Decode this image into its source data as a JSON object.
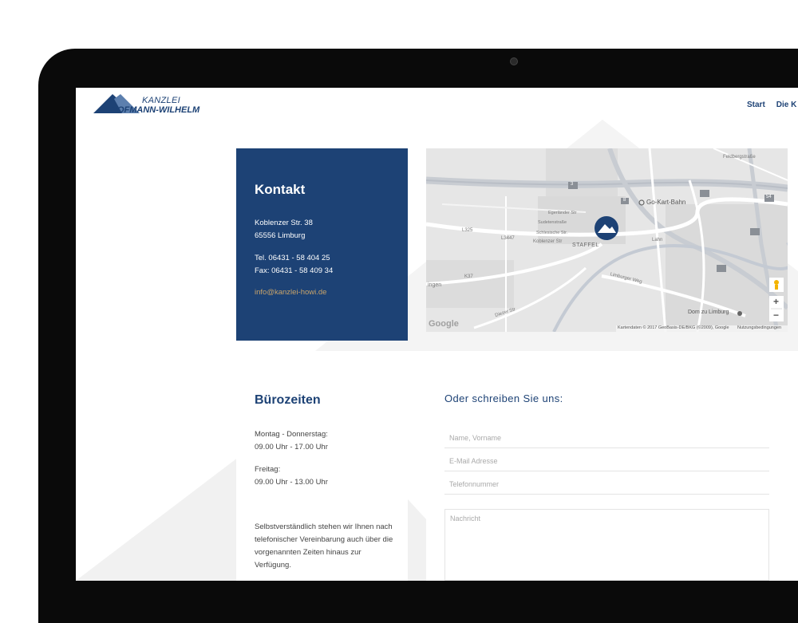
{
  "logo": {
    "top": "KANZLEI",
    "main": "HOFMANN-WILHELM"
  },
  "nav": {
    "items": [
      "Start",
      "Die K"
    ]
  },
  "contact": {
    "title": "Kontakt",
    "street": "Koblenzer Str. 38",
    "city": "65556 Limburg",
    "tel": "Tel. 06431 - 58 404 25",
    "fax": "Fax: 06431 - 58 409 34",
    "email": "info@kanzlei-howi.de"
  },
  "map": {
    "labels": {
      "gokart": "Go-Kart-Bahn",
      "staffel": "STAFFEL",
      "koblenzer": "Koblenzer Str",
      "limburger": "Limburger Weg",
      "dom": "Dom zu Limburg",
      "l3447": "L3447",
      "l325": "L325",
      "k37": "K37",
      "diezer": "Diezer Str",
      "feldberg": "Feldbergstraße",
      "lahn": "Lahn",
      "egerlaender": "Egerländer Str",
      "sudeten": "Sudetenstraße",
      "schlesische": "Schlesische Str.",
      "ingen": "ingen",
      "r3": "3",
      "r8": "8",
      "r54": "54"
    },
    "google": "Google",
    "attribution": "Kartendaten © 2017 GeoBasis-DE/BKG (©2009), Google",
    "terms": "Nutzungsbedingungen",
    "zoom_in": "+",
    "zoom_out": "−",
    "colors": {
      "marker": "#1d4275"
    }
  },
  "hours": {
    "title": "Bürozeiten",
    "mon_thu_label": "Montag - Donnerstag:",
    "mon_thu_time": "09.00 Uhr - 17.00 Uhr",
    "fri_label": "Freitag:",
    "fri_time": "09.00 Uhr - 13.00 Uhr",
    "note_1": "Selbstverständlich stehen wir Ihnen nach",
    "note_2": "telefonischer Vereinbarung auch über die",
    "note_3": "vorgenannten Zeiten hinaus zur",
    "note_4": "Verfügung."
  },
  "form": {
    "title": "Oder schreiben Sie uns:",
    "name_placeholder": "Name, Vorname",
    "email_placeholder": "E-Mail Adresse",
    "phone_placeholder": "Telefonnummer",
    "message_placeholder": "Nachricht"
  },
  "colors": {
    "brand": "#1d4275",
    "link": "#c9a46a"
  }
}
